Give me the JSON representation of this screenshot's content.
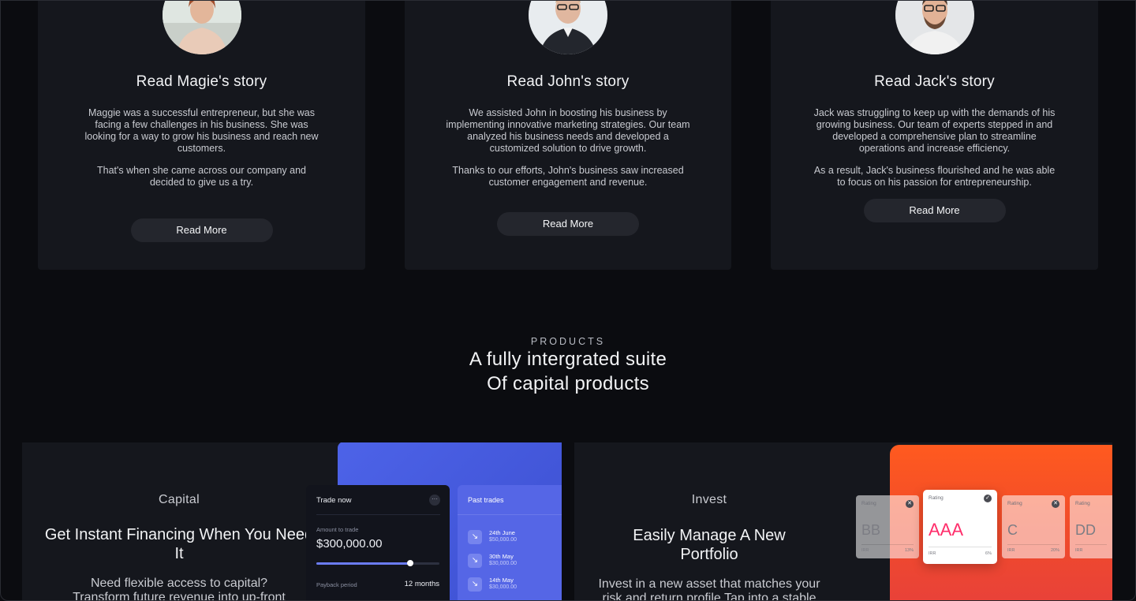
{
  "stories": [
    {
      "title": "Read Magie's story",
      "paragraphs": [
        "Maggie was a successful entrepreneur, but she was facing a few challenges in his business. She was looking for a way to grow his business and reach new customers.",
        "That's when she came across our company and decided to give us a try."
      ],
      "button": "Read More"
    },
    {
      "title": "Read John's story",
      "paragraphs": [
        "We assisted John in boosting his business by implementing innovative marketing strategies. Our team analyzed his business needs and developed a customized solution to drive growth.",
        "Thanks to our efforts, John's business saw increased customer engagement and revenue."
      ],
      "button": "Read More"
    },
    {
      "title": "Read Jack's story",
      "paragraphs": [
        "Jack was struggling to keep up with the demands of his growing business. Our team of experts stepped in and developed a comprehensive plan to streamline operations and increase efficiency.",
        "As a result, Jack's business flourished and he was able to focus on his passion for entrepreneurship."
      ],
      "button": "Read More"
    }
  ],
  "products": {
    "label": "PRODUCTS",
    "title_line1": "A fully intergrated suite",
    "title_line2": "Of capital products"
  },
  "capital": {
    "category": "Capital",
    "title": "Get Instant Financing When You Need It",
    "desc_line1": "Need flexible access to capital?",
    "desc_line2": "Transform future revenue into up-front",
    "trade": {
      "header": "Trade now",
      "menu_icon": "more-dots-icon",
      "amount_label": "Amount to trade",
      "amount": "$300,000.00",
      "slider_fraction": 0.76,
      "payback_label": "Payback period",
      "payback_value": "12 months"
    },
    "past": {
      "header": "Past trades",
      "items": [
        {
          "date": "24th June",
          "amount": "$50,000.00"
        },
        {
          "date": "30th May",
          "amount": "$30,000.00"
        },
        {
          "date": "14th May",
          "amount": "$30,000.00"
        }
      ]
    }
  },
  "invest": {
    "category": "Invest",
    "title": "Easily Manage A New Portfolio",
    "desc_line1": "Invest in a new asset that matches your",
    "desc_line2": "risk and return profile Tap into a stable",
    "ratings": [
      {
        "label": "Rating",
        "grade": "BB",
        "irr": "IRR",
        "pct": "13%",
        "selected": false
      },
      {
        "label": "Rating",
        "grade": "AAA",
        "irr": "IRR",
        "pct": "6%",
        "selected": true
      },
      {
        "label": "Rating",
        "grade": "C",
        "irr": "IRR",
        "pct": "20%",
        "selected": false
      },
      {
        "label": "Rating",
        "grade": "DD",
        "irr": "IRR",
        "pct": "",
        "selected": false
      }
    ]
  },
  "colors": {
    "background": "#0b0c10",
    "card": "#15171d",
    "button": "#24262d",
    "capital_accent": "#4d63e8",
    "invest_accent": "#ff5a1f"
  }
}
